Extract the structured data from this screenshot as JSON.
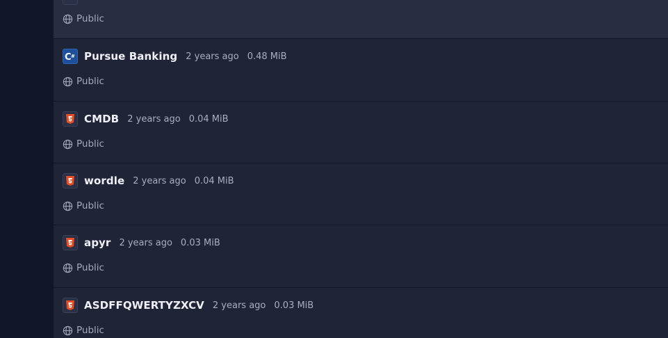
{
  "colors": {
    "background": "#1f2437",
    "sidebar": "#111729",
    "name_text": "#eef0f6",
    "meta_text": "#a9aec0",
    "html5_orange": "#e44d26",
    "csharp_blue": "#1d4f9a"
  },
  "repos": [
    {
      "name": "",
      "updated": "",
      "size": "",
      "visibility": "Public",
      "language_icon": "unknown-icon"
    },
    {
      "name": "Pursue Banking",
      "updated": "2 years ago",
      "size": "0.48 MiB",
      "visibility": "Public",
      "language_icon": "csharp-icon"
    },
    {
      "name": "CMDB",
      "updated": "2 years ago",
      "size": "0.04 MiB",
      "visibility": "Public",
      "language_icon": "html5-icon"
    },
    {
      "name": "wordle",
      "updated": "2 years ago",
      "size": "0.04 MiB",
      "visibility": "Public",
      "language_icon": "html5-icon"
    },
    {
      "name": "apyr",
      "updated": "2 years ago",
      "size": "0.03 MiB",
      "visibility": "Public",
      "language_icon": "html5-icon"
    },
    {
      "name": "ASDFFQWERTYZXCV",
      "updated": "2 years ago",
      "size": "0.03 MiB",
      "visibility": "Public",
      "language_icon": "html5-icon"
    }
  ]
}
